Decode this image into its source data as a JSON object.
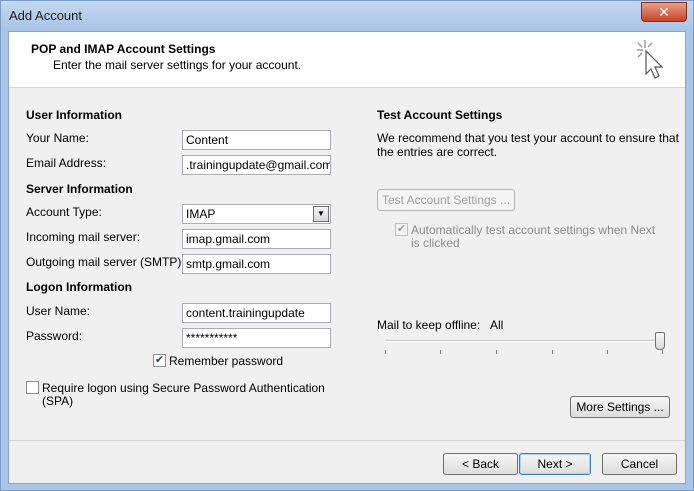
{
  "window": {
    "title": "Add Account",
    "close_glyph": "✕"
  },
  "header": {
    "title": "POP and IMAP Account Settings",
    "subtitle": "Enter the mail server settings for your account.",
    "icon": "cursor-sparkle-icon"
  },
  "user_info": {
    "heading": "User Information",
    "name_label": "Your Name:",
    "name_value": "Content",
    "email_label": "Email Address:",
    "email_value": ".trainingupdate@gmail.com"
  },
  "server_info": {
    "heading": "Server Information",
    "account_type_label": "Account Type:",
    "account_type_value": "IMAP",
    "incoming_label": "Incoming mail server:",
    "incoming_value": "imap.gmail.com",
    "outgoing_label": "Outgoing mail server (SMTP):",
    "outgoing_value": "smtp.gmail.com"
  },
  "logon_info": {
    "heading": "Logon Information",
    "username_label": "User Name:",
    "username_value": "content.trainingupdate",
    "password_label": "Password:",
    "password_value": "***********",
    "remember_label": "Remember password",
    "remember_checked": true,
    "spa_label_line1": "Require logon using Secure Password Authentication",
    "spa_label_line2": "(SPA)",
    "spa_checked": false
  },
  "test_settings": {
    "heading": "Test Account Settings",
    "desc_line1": "We recommend that you test your account to ensure that",
    "desc_line2": "the entries are correct.",
    "test_button": "Test Account Settings ...",
    "auto_test_line1": "Automatically test account settings when Next",
    "auto_test_line2": "is clicked",
    "auto_test_checked": true
  },
  "offline": {
    "label": "Mail to keep offline:",
    "value": "All",
    "slider_level": 1.0
  },
  "buttons": {
    "more_settings": "More Settings ...",
    "back": "< Back",
    "next": "Next >",
    "cancel": "Cancel"
  }
}
